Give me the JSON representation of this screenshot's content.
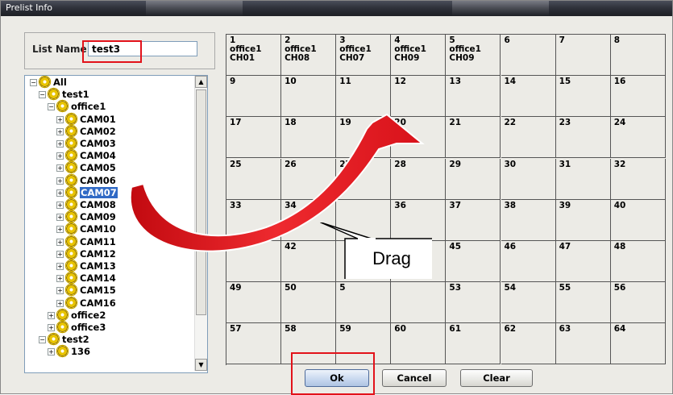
{
  "window": {
    "title": "Prelist Info"
  },
  "list_name": {
    "label": "List Name:",
    "value": "test3"
  },
  "tree": {
    "rows": [
      {
        "label": "All",
        "level": 0,
        "toggle": "−"
      },
      {
        "label": "test1",
        "level": 1,
        "toggle": "−"
      },
      {
        "label": "office1",
        "level": 2,
        "toggle": "−"
      },
      {
        "label": "CAM01",
        "level": 3,
        "toggle": "+"
      },
      {
        "label": "CAM02",
        "level": 3,
        "toggle": "+"
      },
      {
        "label": "CAM03",
        "level": 3,
        "toggle": "+"
      },
      {
        "label": "CAM04",
        "level": 3,
        "toggle": "+"
      },
      {
        "label": "CAM05",
        "level": 3,
        "toggle": "+"
      },
      {
        "label": "CAM06",
        "level": 3,
        "toggle": "+"
      },
      {
        "label": "CAM07",
        "level": 3,
        "toggle": "+",
        "selected": true
      },
      {
        "label": "CAM08",
        "level": 3,
        "toggle": "+"
      },
      {
        "label": "CAM09",
        "level": 3,
        "toggle": "+"
      },
      {
        "label": "CAM10",
        "level": 3,
        "toggle": "+"
      },
      {
        "label": "CAM11",
        "level": 3,
        "toggle": "+"
      },
      {
        "label": "CAM12",
        "level": 3,
        "toggle": "+"
      },
      {
        "label": "CAM13",
        "level": 3,
        "toggle": "+"
      },
      {
        "label": "CAM14",
        "level": 3,
        "toggle": "+"
      },
      {
        "label": "CAM15",
        "level": 3,
        "toggle": "+"
      },
      {
        "label": "CAM16",
        "level": 3,
        "toggle": "+"
      },
      {
        "label": "office2",
        "level": 2,
        "toggle": "+"
      },
      {
        "label": "office3",
        "level": 2,
        "toggle": "+"
      },
      {
        "label": "test2",
        "level": 1,
        "toggle": "−"
      },
      {
        "label": "136",
        "level": 2,
        "toggle": "+"
      }
    ]
  },
  "grid": {
    "cells": [
      "1\noffice1\nCH01",
      "2\noffice1\nCH08",
      "3\noffice1\nCH07",
      "4\noffice1\nCH09",
      "5\noffice1\nCH09",
      "6",
      "7",
      "8",
      "9",
      "10",
      "11",
      "12",
      "13",
      "14",
      "15",
      "16",
      "17",
      "18",
      "19",
      "20",
      "21",
      "22",
      "23",
      "24",
      "25",
      "26",
      "27",
      "28",
      "29",
      "30",
      "31",
      "32",
      "33",
      "34",
      "",
      "36",
      "37",
      "38",
      "39",
      "40",
      "41",
      "42",
      "",
      "",
      "45",
      "46",
      "47",
      "48",
      "49",
      "50",
      "5",
      "",
      "53",
      "54",
      "55",
      "56",
      "57",
      "58",
      "59",
      "60",
      "61",
      "62",
      "63",
      "64"
    ]
  },
  "buttons": {
    "ok": "Ok",
    "cancel": "Cancel",
    "clear": "Clear"
  },
  "callout": {
    "text": "Drag"
  },
  "colors": {
    "highlight": "#e2121a",
    "arrow": "#e8151c",
    "selection": "#316ac5"
  }
}
